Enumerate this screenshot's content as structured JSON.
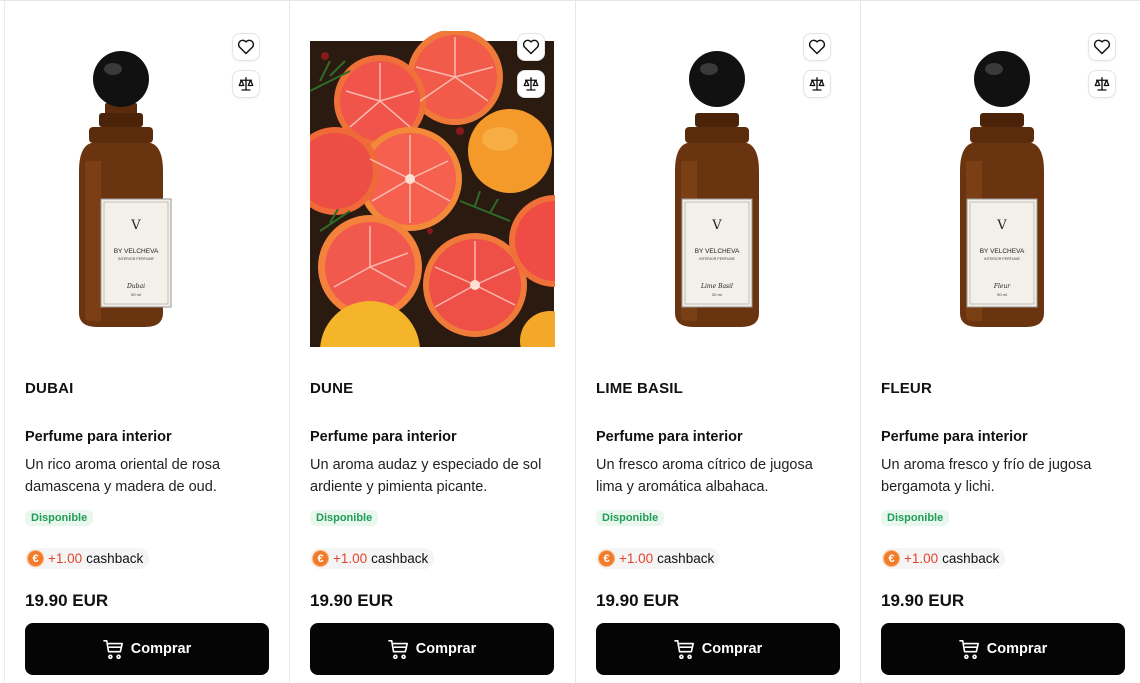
{
  "colors": {
    "button_bg": "#050505",
    "badge_text": "#1f9d55",
    "cashback_amount": "#e2452f",
    "coin": "#f07b2a"
  },
  "icons": {
    "favorite": "heart-icon",
    "compare": "scale-icon",
    "cart": "cart-icon",
    "coin": "euro-coin-icon"
  },
  "products": [
    {
      "image": "perfume-bottle",
      "bottle_brand": "BY VELCHEVA",
      "bottle_subbrand": "INTERIOR PERFUME",
      "bottle_scent": "Dubai",
      "bottle_volume": "50 ml",
      "title": "DUBAI",
      "subtitle": "Perfume para interior",
      "description": "Un rico aroma oriental de rosa damascena y madera de oud.",
      "badge": "Disponible",
      "cashback_amount": "+1.00",
      "cashback_label": "cashback",
      "coin_symbol": "€",
      "price": "19.90 EUR",
      "buy_label": "Comprar"
    },
    {
      "image": "grapefruit-photo",
      "title": "DUNE",
      "subtitle": "Perfume para interior",
      "description": "Un aroma audaz y especiado de sol ardiente y pimienta picante.",
      "badge": "Disponible",
      "cashback_amount": "+1.00",
      "cashback_label": "cashback",
      "coin_symbol": "€",
      "price": "19.90 EUR",
      "buy_label": "Comprar"
    },
    {
      "image": "perfume-bottle",
      "bottle_brand": "BY VELCHEVA",
      "bottle_subbrand": "INTERIOR PERFUME",
      "bottle_scent": "Lime Basil",
      "bottle_volume": "50 ml",
      "title": "LIME BASIL",
      "subtitle": "Perfume para interior",
      "description": "Un fresco aroma cítrico de jugosa lima y aromática albahaca.",
      "badge": "Disponible",
      "cashback_amount": "+1.00",
      "cashback_label": "cashback",
      "coin_symbol": "€",
      "price": "19.90 EUR",
      "buy_label": "Comprar"
    },
    {
      "image": "perfume-bottle",
      "bottle_brand": "BY VELCHEVA",
      "bottle_subbrand": "INTERIOR PERFUME",
      "bottle_scent": "Fleur",
      "bottle_volume": "50 ml",
      "title": "FLEUR",
      "subtitle": "Perfume para interior",
      "description": "Un aroma fresco y frío de jugosa bergamota y lichi.",
      "badge": "Disponible",
      "cashback_amount": "+1.00",
      "cashback_label": "cashback",
      "coin_symbol": "€",
      "price": "19.90 EUR",
      "buy_label": "Comprar"
    }
  ]
}
